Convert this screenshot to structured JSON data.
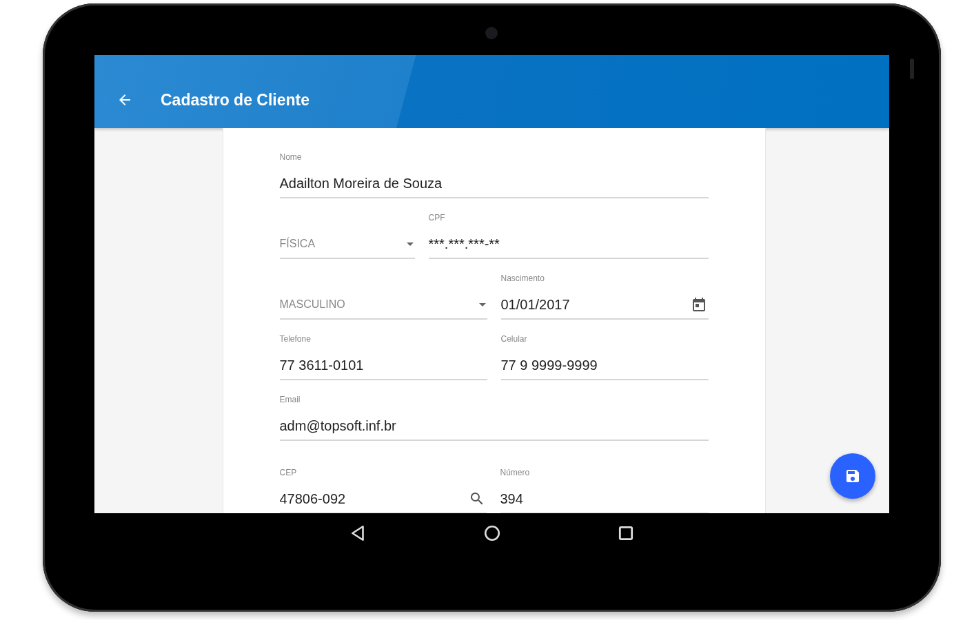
{
  "app_bar": {
    "title": "Cadastro de Cliente"
  },
  "form": {
    "rows": [
      {
        "fields": [
          {
            "kind": "text",
            "label": "Nome",
            "value": "Adailton Moreira de Souza"
          }
        ]
      },
      {
        "fields": [
          {
            "kind": "select",
            "value": "FÍSICA"
          },
          {
            "kind": "text",
            "label": "CPF",
            "value": "***.***.***-**"
          }
        ]
      },
      {
        "fields": [
          {
            "kind": "select",
            "value": "MASCULINO"
          },
          {
            "kind": "date",
            "label": "Nascimento",
            "value": "01/01/2017"
          }
        ]
      },
      {
        "fields": [
          {
            "kind": "text",
            "label": "Telefone",
            "value": "77 3611-0101"
          },
          {
            "kind": "text",
            "label": "Celular",
            "value": "77 9 9999-9999"
          }
        ]
      },
      {
        "fields": [
          {
            "kind": "text",
            "label": "Email",
            "value": "adm@topsoft.inf.br"
          }
        ]
      },
      {
        "fields": [
          {
            "kind": "search",
            "label": "CEP",
            "value": "47806-092"
          },
          {
            "kind": "text",
            "label": "Número",
            "value": "394"
          }
        ]
      }
    ]
  }
}
